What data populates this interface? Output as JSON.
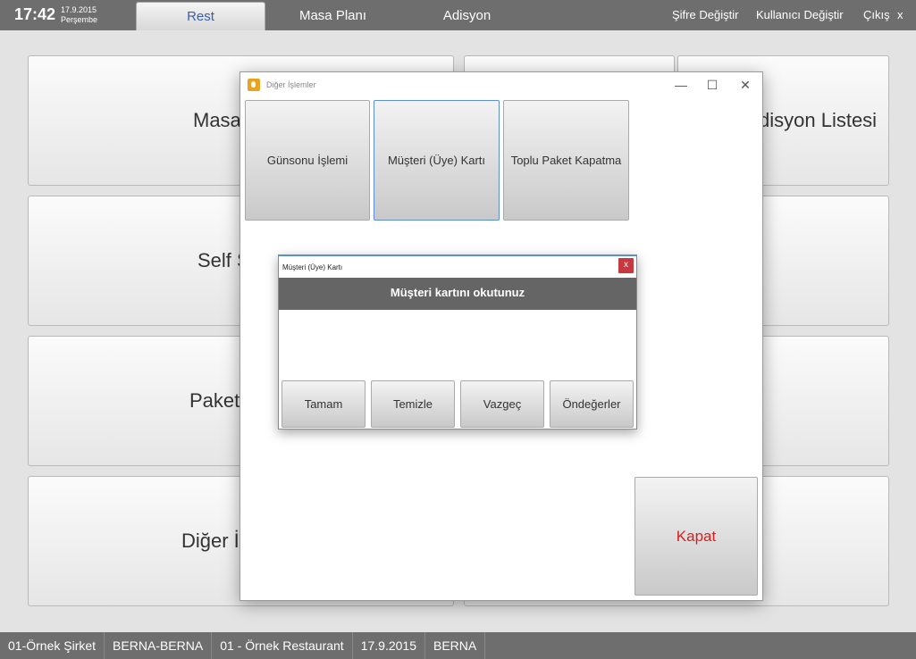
{
  "topbar": {
    "time": "17:42",
    "date": "17.9.2015",
    "day": "Perşembe",
    "tabs": [
      "Rest",
      "Masa Planı",
      "Adisyon"
    ],
    "links": {
      "change_password": "Şifre Değiştir",
      "change_user": "Kullanıcı Değiştir",
      "logout": "Çıkış",
      "close": "x"
    }
  },
  "tiles": {
    "masa": "Masa",
    "adisyon_listesi": "disyon Listesi",
    "self_service": "Self S",
    "paket": "Paket",
    "diger": "Diğer İ"
  },
  "window": {
    "title": "Diğer İşlemler",
    "minimize": "—",
    "maximize": "☐",
    "close": "✕",
    "buttons": {
      "gunsonu": "Günsonu İşlemi",
      "musteri": "Müşteri (Üye) Kartı",
      "toplu": "Toplu Paket Kapatma",
      "kapat": "Kapat"
    }
  },
  "dialog": {
    "title": "Müşteri (Üye) Kartı",
    "close": "x",
    "header": "Müşteri kartını okutunuz",
    "buttons": {
      "ok": "Tamam",
      "clear": "Temizle",
      "cancel": "Vazgeç",
      "defaults": "Öndeğerler"
    }
  },
  "statusbar": [
    "01-Örnek Şirket",
    "BERNA-BERNA",
    "01 - Örnek Restaurant",
    "17.9.2015",
    "BERNA"
  ]
}
